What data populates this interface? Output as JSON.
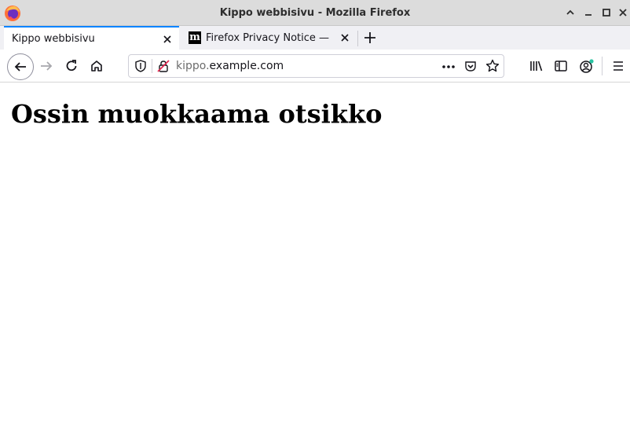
{
  "window": {
    "title": "Kippo webbisivu - Mozilla Firefox"
  },
  "tabs": [
    {
      "label": "Kippo webbisivu",
      "active": true
    },
    {
      "label": "Firefox Privacy Notice —",
      "active": false
    }
  ],
  "urlbar": {
    "subdomain": "kippo.",
    "host": "example.com"
  },
  "page": {
    "heading": "Ossin muokkaama otsikko"
  },
  "colors": {
    "accent": "#0a84ff",
    "titlebar": "#dcdcdc",
    "tabstrip": "#f0f0f4"
  }
}
